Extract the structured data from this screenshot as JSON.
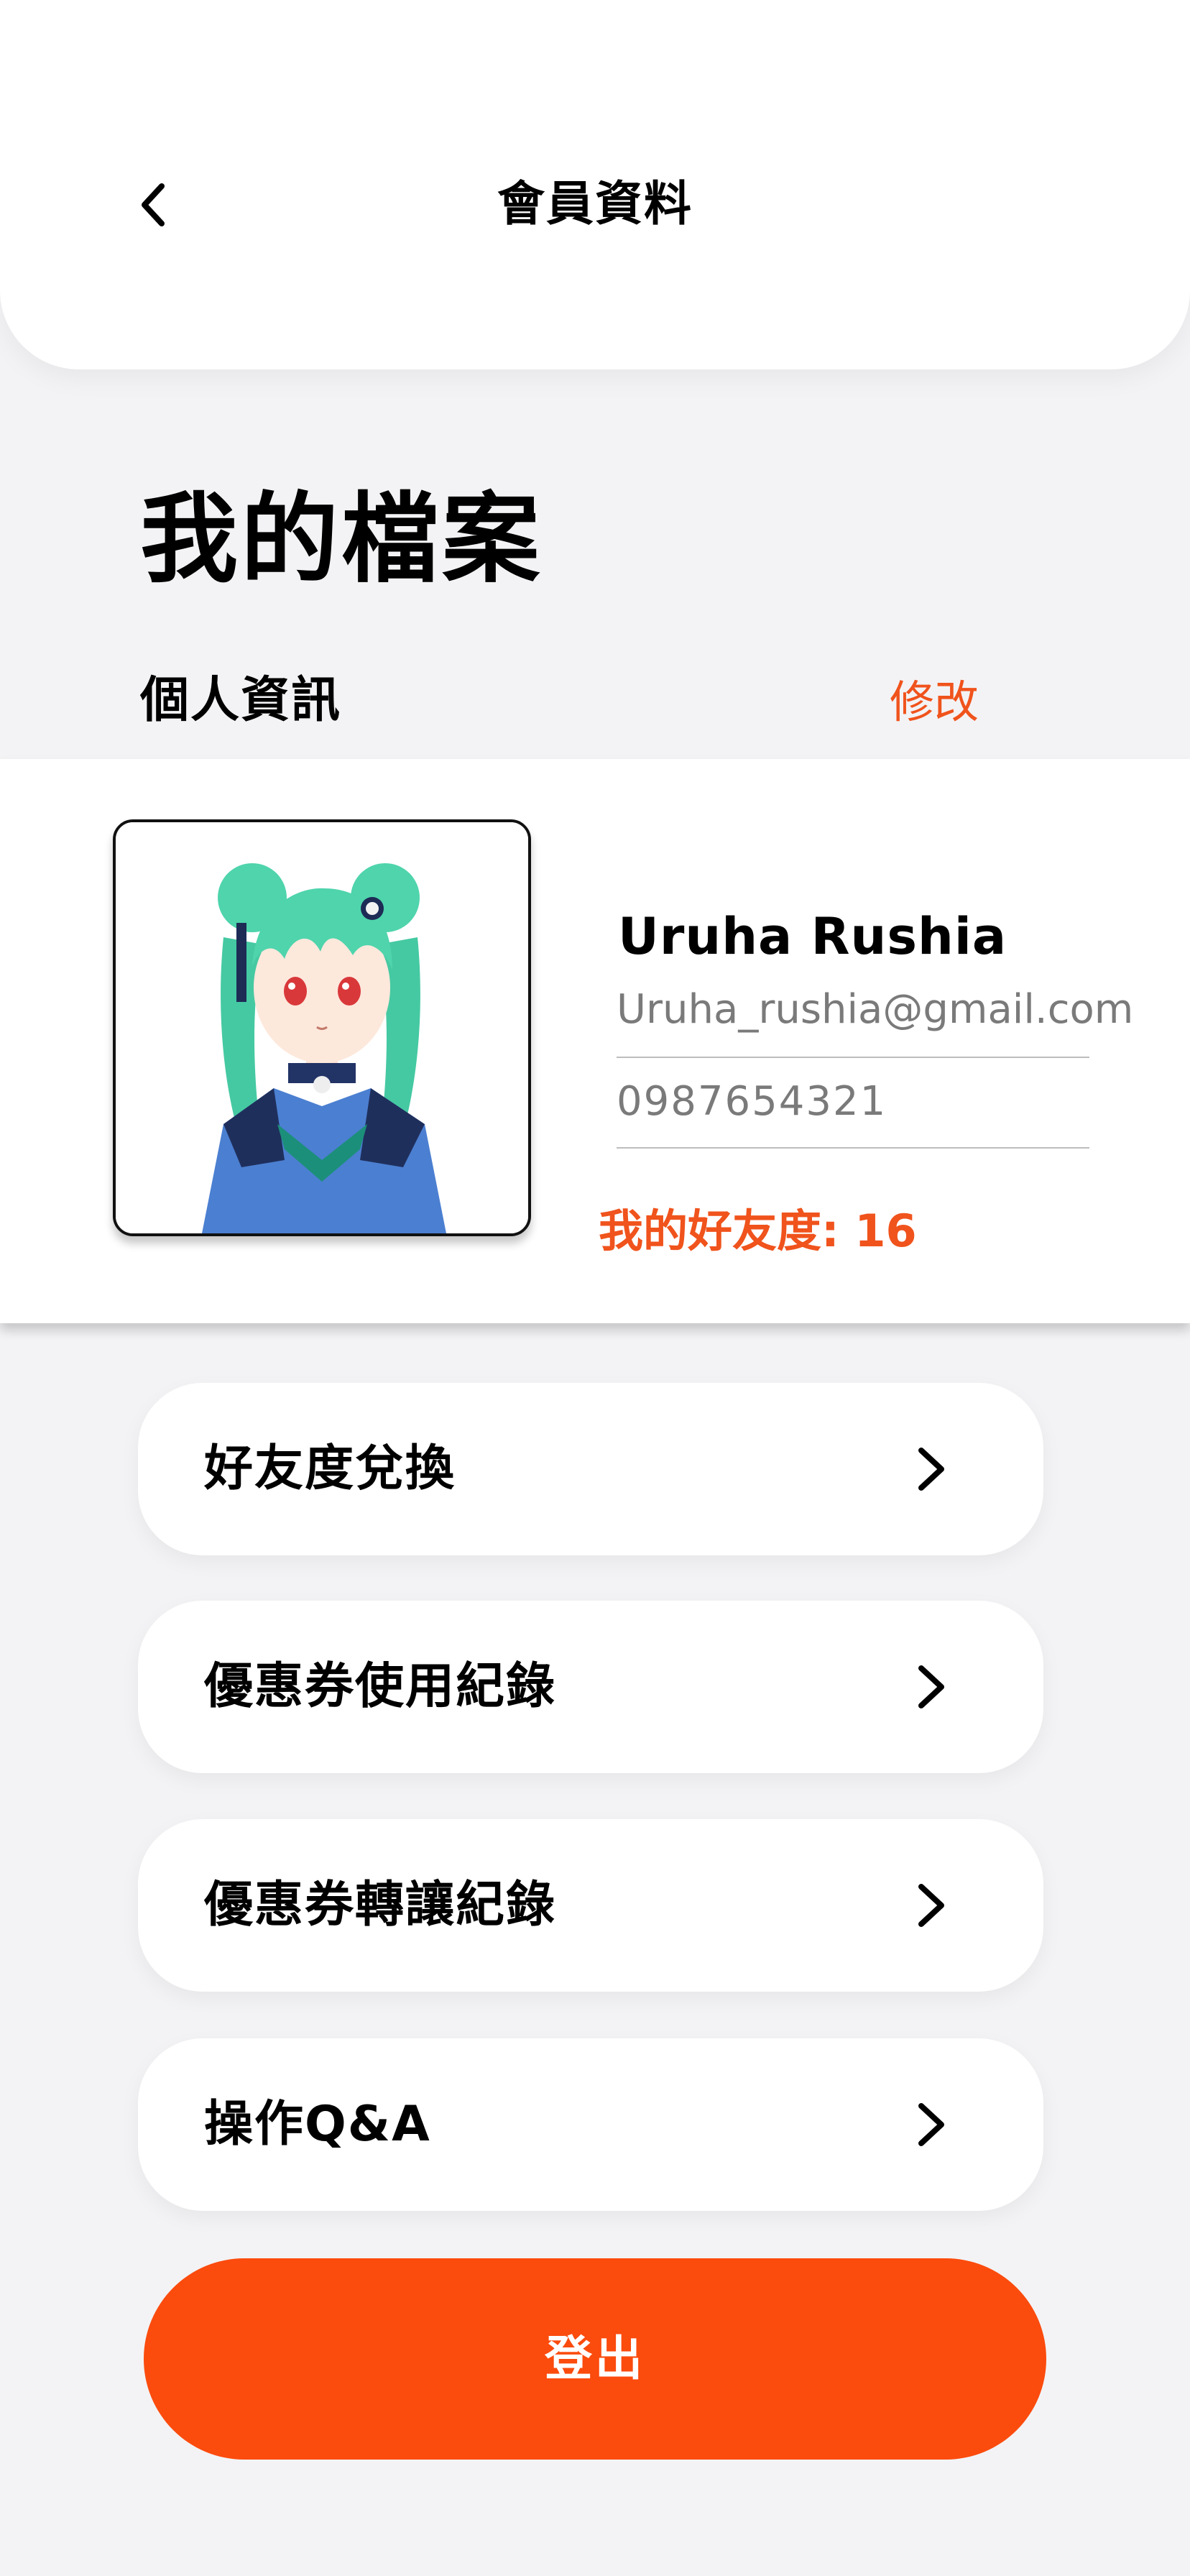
{
  "header": {
    "title": "會員資料",
    "back_icon": "chevron-left-icon"
  },
  "page": {
    "title": "我的檔案"
  },
  "profile_section": {
    "title": "個人資訊",
    "edit_label": "修改"
  },
  "profile": {
    "avatar_icon": "user-avatar-illustration",
    "name": "Uruha Rushia",
    "email": "Uruha_rushia@gmail.com",
    "phone": "0987654321",
    "friendship_label": "我的好友度: 16"
  },
  "menu": {
    "items": [
      {
        "label": "好友度兌換",
        "icon": "chevron-right-icon"
      },
      {
        "label": "優惠券使用紀錄",
        "icon": "chevron-right-icon"
      },
      {
        "label": "優惠券轉讓紀錄",
        "icon": "chevron-right-icon"
      },
      {
        "label": "操作Q&A",
        "icon": "chevron-right-icon"
      }
    ]
  },
  "logout": {
    "label": "登出"
  },
  "colors": {
    "accent": "#f0531c",
    "button": "#fb4b0d",
    "background": "#f3f3f5",
    "card": "#ffffff",
    "muted_text": "#7a7a7a"
  }
}
